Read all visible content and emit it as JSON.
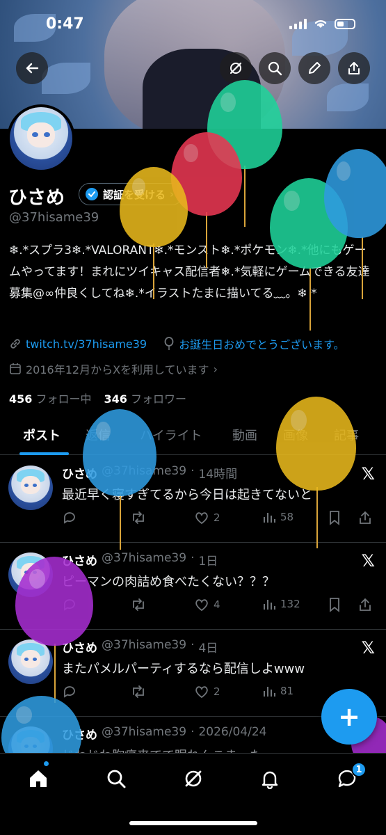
{
  "status_bar": {
    "time": "0:47"
  },
  "profile": {
    "name": "ひさめ",
    "verify_label": "認証を受ける",
    "handle": "@37hisame39",
    "bio": "❄.*スプラ3❄.*VALORANT❄.*モンスト❄.*ポケモン❄.*他にもゲームやってます！まれにツイキャス配信者❄.*気軽にゲームできる友達募集@∞仲良くしてね❄.*イラストたまに描いてる﹏。❄ *",
    "link": "twitch.tv/37hisame39",
    "birthday": "お誕生日おめでとうございます。",
    "joined": "2016年12月からXを利用しています",
    "following_count": "456",
    "following_label": "フォロー中",
    "followers_count": "346",
    "followers_label": "フォロワー"
  },
  "tabs": [
    "ポスト",
    "返信",
    "ハイライト",
    "動画",
    "画像",
    "記事"
  ],
  "posts": [
    {
      "name": "ひさめ",
      "handle": "@37hisame39",
      "time": "14時間",
      "text": "最近早く寝すぎてるから今日は起きてないと",
      "replies": "",
      "reposts": "",
      "likes": "2",
      "views": "58"
    },
    {
      "name": "ひさめ",
      "handle": "@37hisame39",
      "time": "1日",
      "text": "ピーマンの肉詰め食べたくない？？？",
      "replies": "",
      "reposts": "",
      "likes": "4",
      "views": "132"
    },
    {
      "name": "ひさめ",
      "handle": "@37hisame39",
      "time": "4日",
      "text": "またパメルパーティするなら配信しよwww",
      "replies": "",
      "reposts": "",
      "likes": "2",
      "views": "81"
    },
    {
      "name": "ひさめ",
      "handle": "@37hisame39",
      "time": "2026/04/24",
      "text": "じわじわ胸痛来てて眠れんこま…た"
    }
  ],
  "x_logo": "𝕏",
  "fab_label": "+",
  "nav": {
    "messages_badge": "1"
  },
  "icons": [
    "back-icon",
    "grok-icon",
    "search-icon",
    "edit-icon",
    "share-icon",
    "link-icon",
    "balloon-icon",
    "calendar-icon",
    "home-icon",
    "bell-icon",
    "chat-icon"
  ],
  "colors": {
    "accent": "#1d9bf0",
    "background": "#000000",
    "muted": "#71767b"
  }
}
